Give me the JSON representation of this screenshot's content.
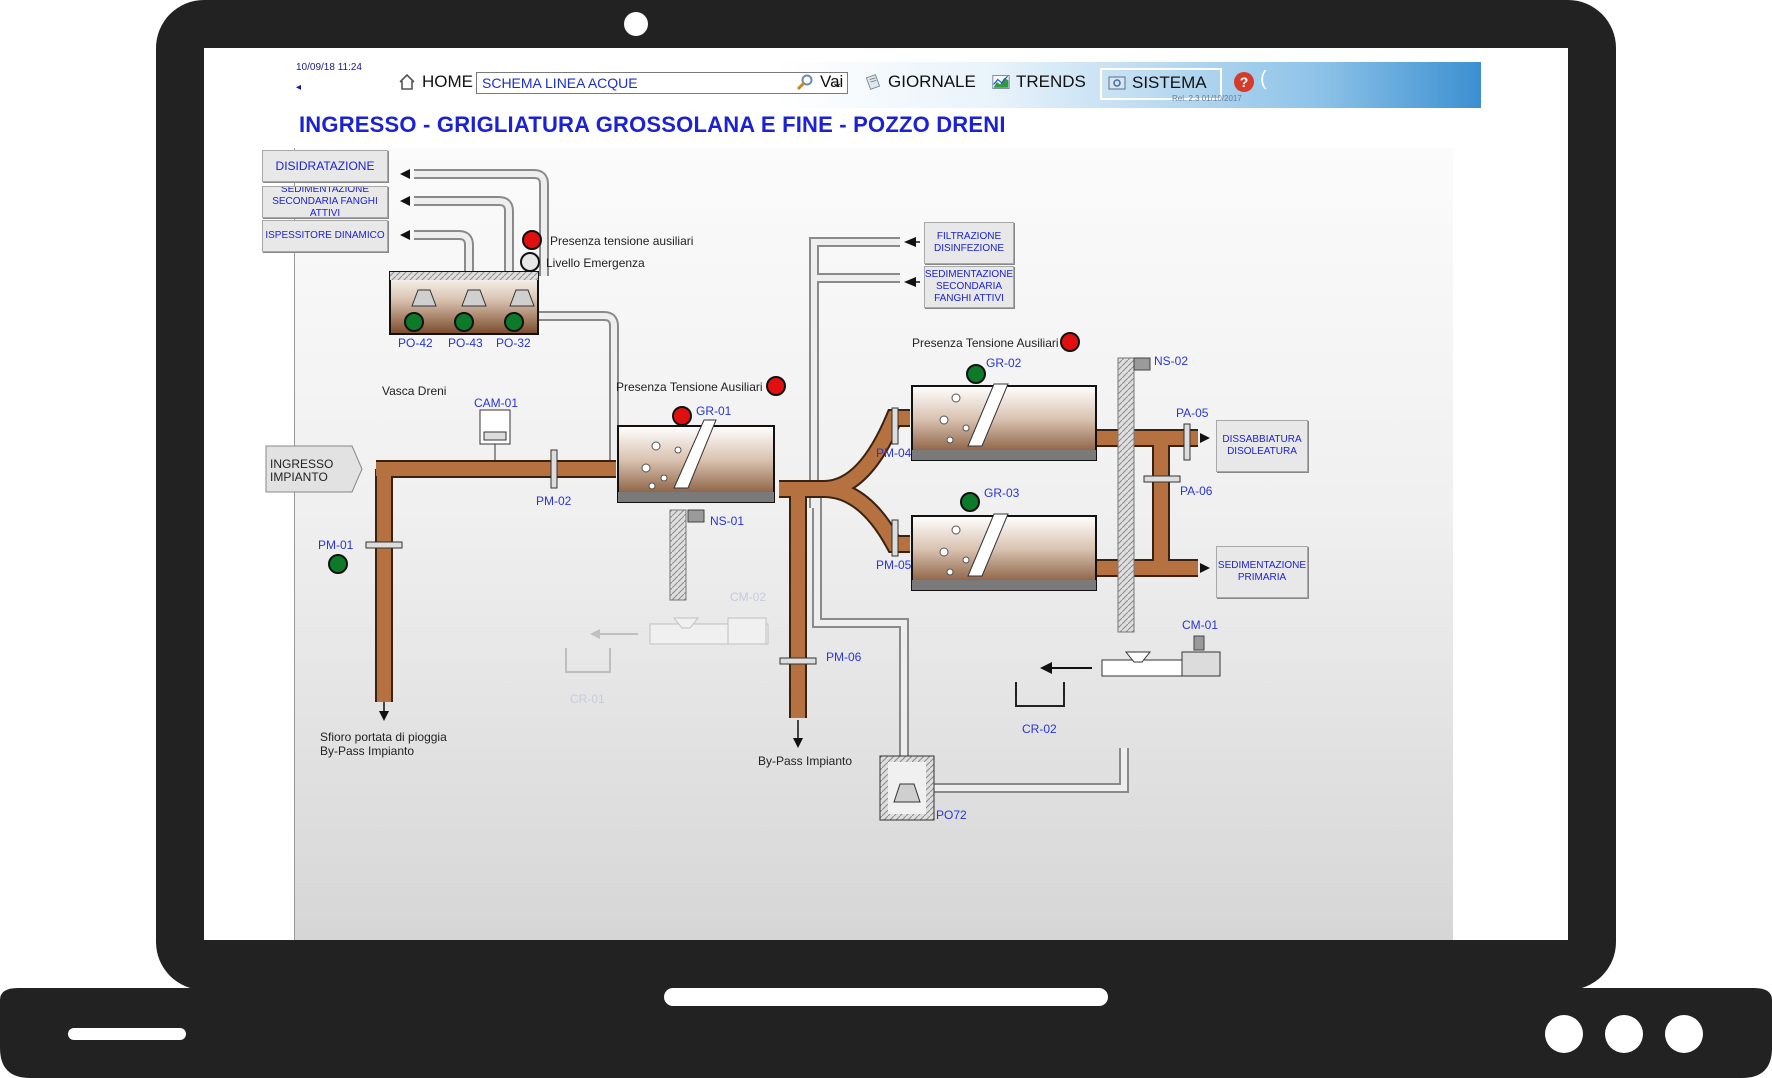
{
  "header": {
    "clock": "10/09/18 11:24",
    "back_glyph": "◂",
    "home_label": "HOME",
    "schema_select_value": "SCHEMA LINEA ACQUE",
    "vai_label": "Vai",
    "giornale_label": "GIORNALE",
    "trends_label": "TRENDS",
    "sistema_label": "SISTEMA",
    "help_label": "?",
    "release": "Rel. 2.3 01/10/2017"
  },
  "page_title": "INGRESSO - GRIGLIATURA GROSSOLANA E FINE - POZZO DRENI",
  "buttons": {
    "disidratazione": "DISIDRATAZIONE",
    "sedimentazione_fanghi_top": "SEDIMENTAZIONE SECONDARIA FANGHI ATTIVI",
    "ispessitore": "ISPESSITORE DINAMICO",
    "filtrazione": "FILTRAZIONE DISINFEZIONE",
    "sedimentazione_right": "SEDIMENTAZIONE SECONDARIA FANGHI ATTIVI",
    "dissabbiatura": "DISSABBIATURA DISOLEATURA",
    "sedimentazione_primaria": "SEDIMENTAZIONE PRIMARIA",
    "ingresso": "INGRESSO IMPIANTO"
  },
  "labels": {
    "presenza_aux_1": "Presenza tensione ausiliari",
    "livello_emergenza": "Livello Emergenza",
    "presenza_aux_2": "Presenza Tensione Ausiliari",
    "presenza_aux_3": "Presenza Tensione Ausiliari",
    "vasca_dreni": "Vasca Dreni",
    "sfioro_1": "Sfioro portata di pioggia",
    "sfioro_2": "By-Pass Impianto",
    "bypass": "By-Pass Impianto"
  },
  "tags": {
    "po42": "PO-42",
    "po43": "PO-43",
    "po32": "PO-32",
    "cam01": "CAM-01",
    "pm01": "PM-01",
    "pm02": "PM-02",
    "gr01": "GR-01",
    "ns01": "NS-01",
    "cm02": "CM-02",
    "cr01": "CR-01",
    "pm04": "PM-04",
    "pm05": "PM-05",
    "pm06": "PM-06",
    "gr02": "GR-02",
    "gr03": "GR-03",
    "ns02": "NS-02",
    "pa05": "PA-05",
    "pa06": "PA-06",
    "cm01": "CM-01",
    "cr02": "CR-02",
    "po72": "PO72"
  },
  "colors": {
    "pipe": "#b5713f",
    "pipe_edge": "#3a2212",
    "alarm_red": "#e01010",
    "ok_green": "#0d7a2a",
    "tag_blue": "#2835d8",
    "title_blue": "#1b22d6"
  }
}
